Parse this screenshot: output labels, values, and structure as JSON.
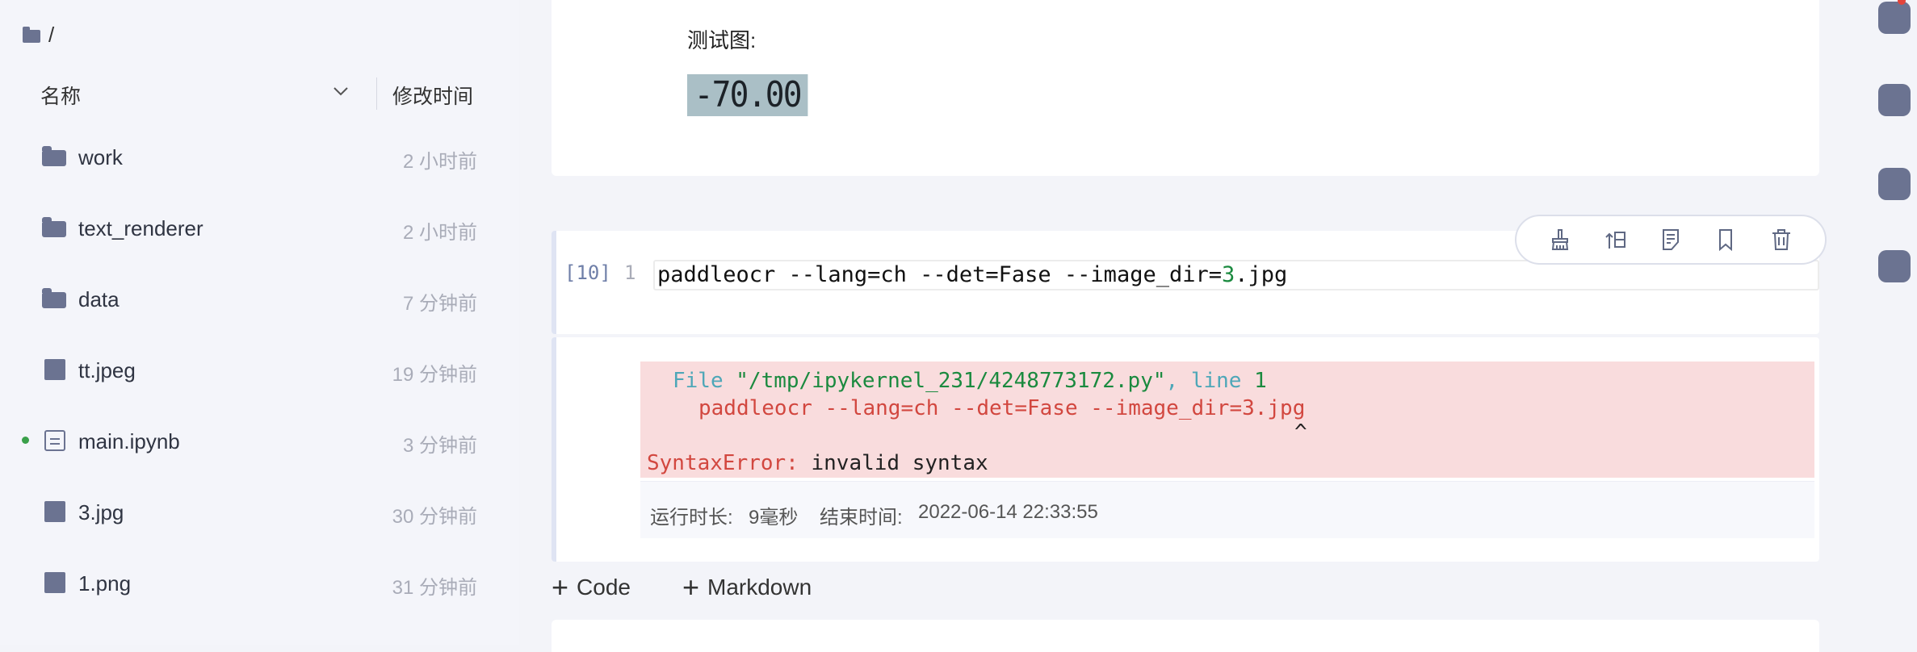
{
  "browser": {
    "path": "/",
    "col_name": "名称",
    "col_modified": "修改时间",
    "files": [
      {
        "name": "work",
        "time": "2 小时前",
        "type": "folder-icon"
      },
      {
        "name": "text_renderer",
        "time": "2 小时前",
        "type": "folder-icon"
      },
      {
        "name": "data",
        "time": "7 分钟前",
        "type": "folder-icon"
      },
      {
        "name": "tt.jpeg",
        "time": "19 分钟前",
        "type": "image-file-icon"
      },
      {
        "name": "main.ipynb",
        "time": "3 分钟前",
        "type": "notebook-icon",
        "active": true
      },
      {
        "name": "3.jpg",
        "time": "30 分钟前",
        "type": "image-file-icon"
      },
      {
        "name": "1.png",
        "time": "31 分钟前",
        "type": "image-file-icon"
      }
    ]
  },
  "notebook": {
    "md_label": "测试图:",
    "lcd_reading": "-70.00",
    "exec_count": "[10]",
    "line_number": "1",
    "code_prefix": "paddleocr --lang=ch --det=Fase --image_dir=",
    "code_num": "3",
    "code_suffix": ".jpg",
    "error": {
      "file_kw": "File ",
      "file_path": "\"/tmp/ipykernel_231/4248773172.py\"",
      "sep": ", ",
      "line_kw": "line ",
      "line_no": "1",
      "source": "paddleocr --lang=ch --det=Fase --image_dir=3.jpg",
      "caret": "^",
      "err_type": "SyntaxError:",
      "err_msg": " invalid syntax"
    },
    "run_time_label": "运行时长:",
    "run_time_value": "9毫秒",
    "end_time_label": "结束时间:",
    "end_time_value": "2022-06-14 22:33:55",
    "add_code": "Code",
    "add_markdown": "Markdown"
  },
  "toolbar_icons": [
    "broom-icon",
    "move-up-icon",
    "format-icon",
    "bookmark-icon",
    "trash-icon"
  ],
  "colors": {
    "accent": "#6b7391",
    "error_bg": "#f9dcdd",
    "active_dot": "#3aa04a"
  }
}
